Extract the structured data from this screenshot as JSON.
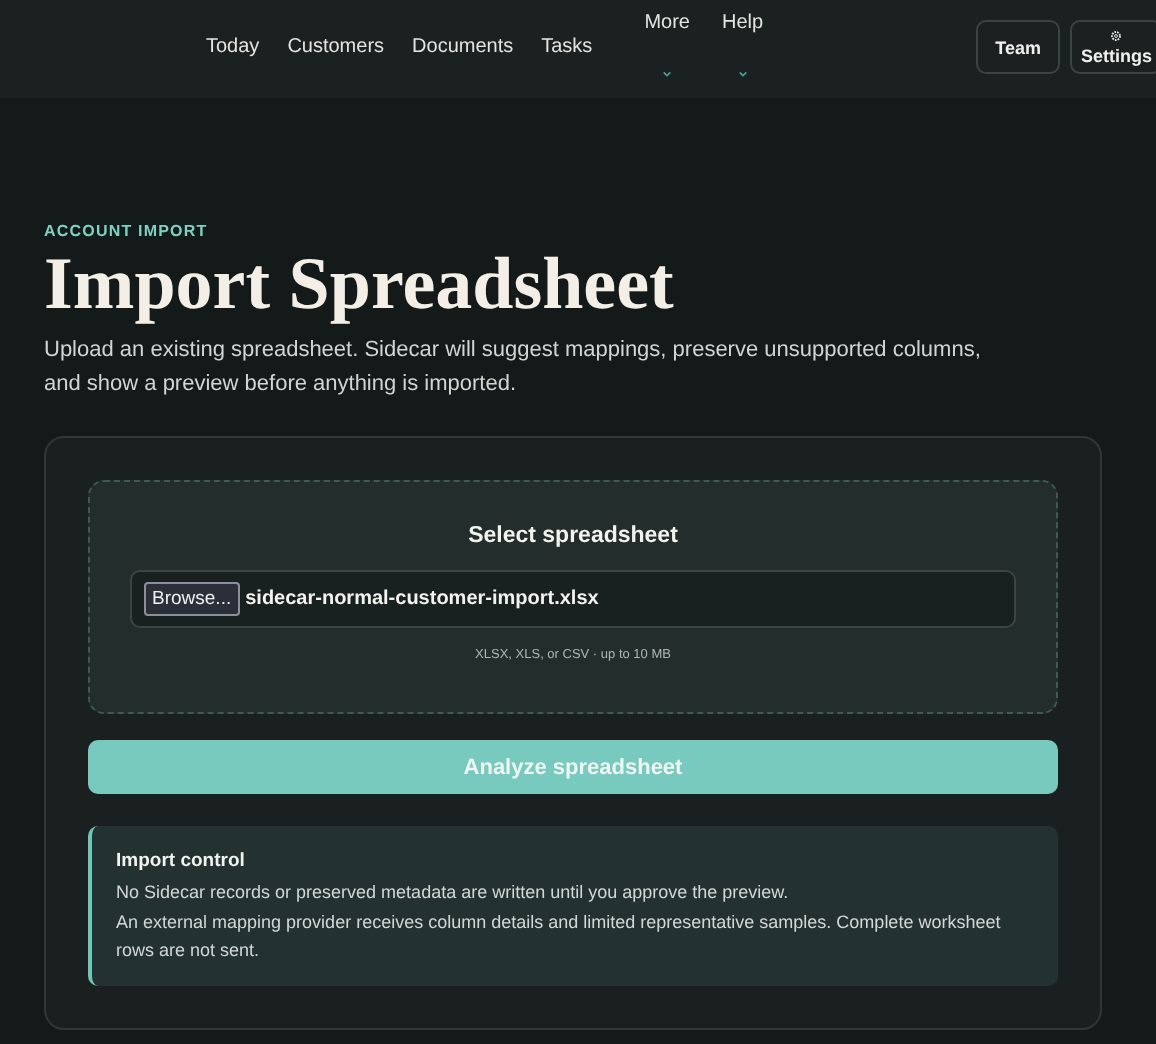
{
  "nav": {
    "links": [
      {
        "label": "Today",
        "kind": "link"
      },
      {
        "label": "Customers",
        "kind": "link"
      },
      {
        "label": "Documents",
        "kind": "link"
      },
      {
        "label": "Tasks",
        "kind": "link"
      },
      {
        "label": "More",
        "kind": "menu"
      },
      {
        "label": "Help",
        "kind": "menu"
      }
    ],
    "buttons": [
      {
        "label": "Team",
        "kind": "plain"
      },
      {
        "label": "Settings",
        "kind": "gear"
      }
    ]
  },
  "eyebrow": "ACCOUNT IMPORT",
  "title": "Import Spreadsheet",
  "description": "Upload an existing spreadsheet. Sidecar will suggest mappings, preserve unsupported columns, and show a preview before anything is imported.",
  "upload": {
    "heading": "Select spreadsheet",
    "browse_label": "Browse...",
    "file_name": "sidecar-normal-customer-import.xlsx",
    "hint": "XLSX, XLS, or CSV · up to 10 MB"
  },
  "analyze_button": "Analyze spreadsheet",
  "notice": {
    "title": "Import control",
    "lines": [
      "No Sidecar records or preserved metadata are written until you approve the preview.",
      "An external mapping provider receives column details and limited representative samples. Complete worksheet rows are not sent."
    ]
  }
}
